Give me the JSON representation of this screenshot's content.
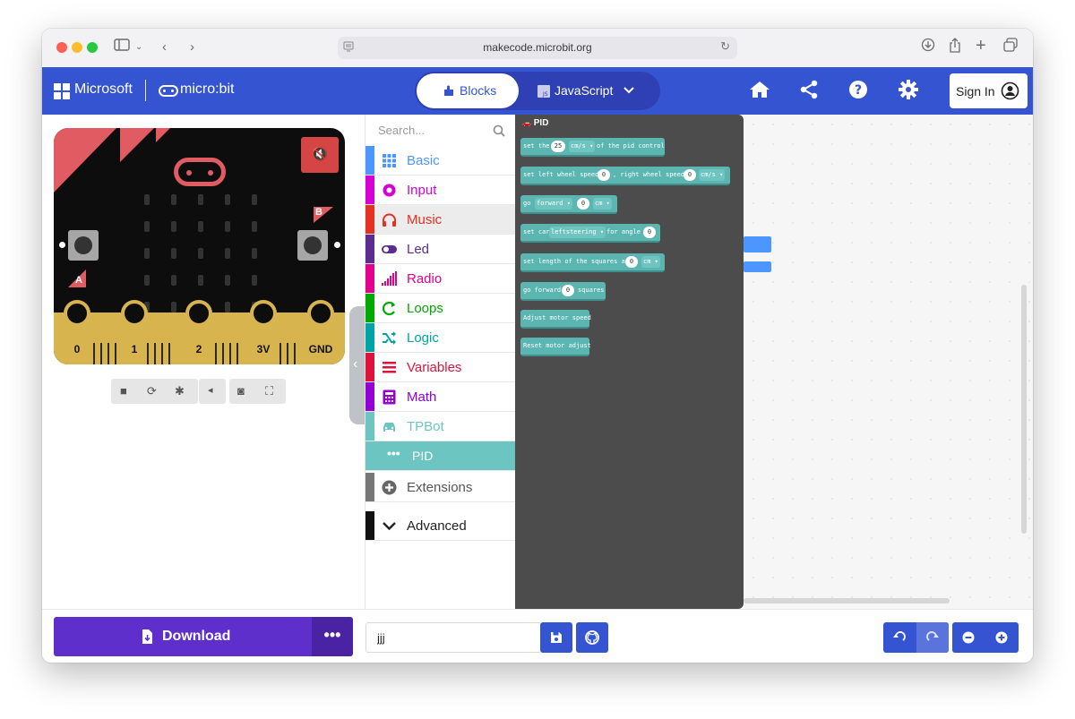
{
  "browser": {
    "url": "makecode.microsoft.org",
    "url_display": "makecode.microbit.org"
  },
  "header": {
    "brand": "Microsoft",
    "product": "micro:bit",
    "tab_blocks": "Blocks",
    "tab_javascript": "JavaScript",
    "sign_in": "Sign In",
    "colors": {
      "header": "#3454d1",
      "toggle": "#2e40b4"
    }
  },
  "simulator": {
    "button_a": "A",
    "button_b": "B",
    "pins": [
      "0",
      "1",
      "2",
      "3V",
      "GND"
    ],
    "colors": {
      "board": "#0d0d0d",
      "accent": "#e05b62",
      "gold": "#d8b44f"
    }
  },
  "toolbox": {
    "search_placeholder": "Search...",
    "categories": [
      {
        "label": "Basic",
        "color": "#4c97ff",
        "icon": "grid-icon"
      },
      {
        "label": "Input",
        "color": "#d400d4",
        "icon": "circle-dot-icon"
      },
      {
        "label": "Music",
        "color": "#e63022",
        "icon": "headphones-icon"
      },
      {
        "label": "Led",
        "color": "#5c2d91",
        "icon": "toggle-icon"
      },
      {
        "label": "Radio",
        "color": "#e3008c",
        "icon": "signal-bars-icon"
      },
      {
        "label": "Loops",
        "color": "#00aa00",
        "icon": "refresh-icon"
      },
      {
        "label": "Logic",
        "color": "#00a4a6",
        "icon": "shuffle-icon"
      },
      {
        "label": "Variables",
        "color": "#dc143c",
        "icon": "list-icon"
      },
      {
        "label": "Math",
        "color": "#9400d3",
        "icon": "calculator-icon"
      },
      {
        "label": "TPBot",
        "color": "#6cc5c1",
        "icon": "car-icon"
      },
      {
        "label": "PID",
        "color": "#6cc5c1",
        "icon": "dots-icon"
      },
      {
        "label": "Extensions",
        "color": "#777777",
        "icon": "plus-circle-icon"
      },
      {
        "label": "Advanced",
        "color": "#111111",
        "icon": "chevron-down-icon"
      }
    ]
  },
  "flyout": {
    "title": "PID",
    "blocks": [
      {
        "t1": "set the",
        "v1": "25",
        "d1": "cm/s ▾",
        "t2": "of the pid control"
      },
      {
        "t1": "set left wheel speed",
        "v1": "0",
        "t2": ", right wheel speed",
        "v2": "0",
        "d1": "cm/s ▾"
      },
      {
        "t1": "go",
        "d1": "forward ▾",
        "v1": "0",
        "d2": "cm ▾"
      },
      {
        "t1": "set car",
        "d1": "leftsteering ▾",
        "t2": "for angle",
        "v1": "0"
      },
      {
        "t1": "set length of the squares as",
        "v1": "0",
        "d1": "cm ▾"
      },
      {
        "t1": "go forward",
        "v1": "0",
        "t2": "squares"
      },
      {
        "t1": "Adjust motor speed"
      },
      {
        "t1": "Reset motor adjust"
      }
    ]
  },
  "bottom": {
    "download": "Download",
    "more": "•••",
    "project_name": "jjj"
  }
}
